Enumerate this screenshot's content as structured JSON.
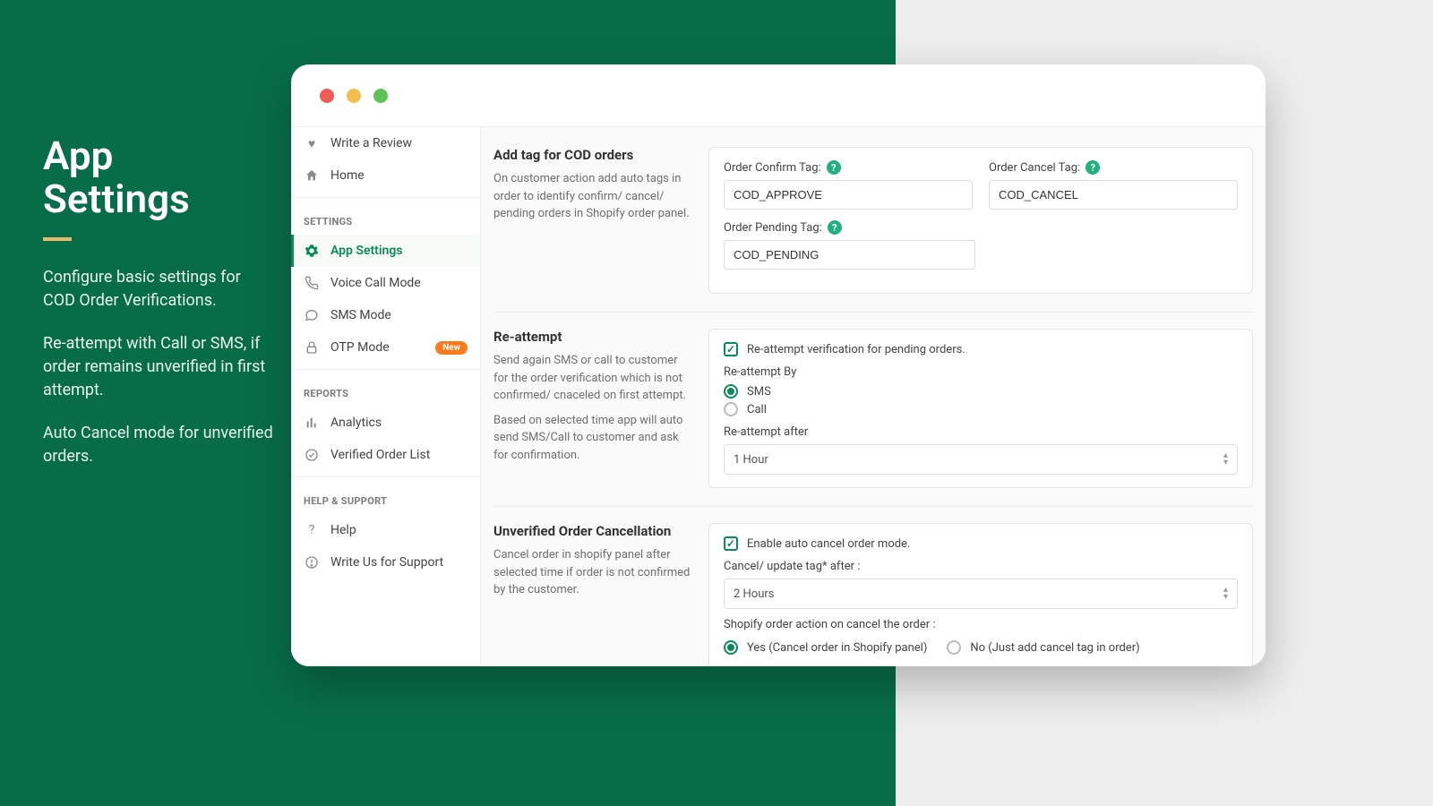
{
  "hero": {
    "title_l1": "App",
    "title_l2": "Settings",
    "p1": "Configure basic settings for COD Order Verifications.",
    "p2": "Re-attempt with Call or SMS, if order remains unverified in first attempt.",
    "p3": "Auto Cancel mode for unverified orders."
  },
  "sidebar": {
    "top": [
      {
        "label": "Write a Review",
        "icon": "heart"
      },
      {
        "label": "Home",
        "icon": "home"
      }
    ],
    "sections": {
      "settings_title": "SETTINGS",
      "reports_title": "REPORTS",
      "help_title": "HELP & SUPPORT"
    },
    "settings": [
      {
        "label": "App Settings",
        "icon": "gear",
        "active": true
      },
      {
        "label": "Voice Call Mode",
        "icon": "phone"
      },
      {
        "label": "SMS Mode",
        "icon": "sms"
      },
      {
        "label": "OTP Mode",
        "icon": "lock",
        "badge": "New"
      }
    ],
    "reports": [
      {
        "label": "Analytics",
        "icon": "chart"
      },
      {
        "label": "Verified Order List",
        "icon": "check-list"
      }
    ],
    "help": [
      {
        "label": "Help",
        "icon": "question"
      },
      {
        "label": "Write Us for Support",
        "icon": "exclaim"
      }
    ]
  },
  "sections": {
    "tags": {
      "title": "Add tag for COD orders",
      "desc": "On customer action add auto tags in order to identify confirm/ cancel/ pending orders in Shopify order panel.",
      "fields": {
        "confirm": {
          "label": "Order Confirm Tag:",
          "value": "COD_APPROVE"
        },
        "cancel": {
          "label": "Order Cancel Tag:",
          "value": "COD_CANCEL"
        },
        "pending": {
          "label": "Order Pending Tag:",
          "value": "COD_PENDING"
        }
      }
    },
    "reattempt": {
      "title": "Re-attempt",
      "desc1": "Send again SMS or call to customer for the order verification which is not confirmed/ cnaceled on first attempt.",
      "desc2": "Based on selected time app will auto send SMS/Call to customer and ask for confirmation.",
      "checkbox": "Re-attempt verification for pending orders.",
      "by_label": "Re-attempt By",
      "by_options": {
        "sms": "SMS",
        "call": "Call"
      },
      "by_selected": "sms",
      "after_label": "Re-attempt after",
      "after_value": "1 Hour"
    },
    "cancel": {
      "title": "Unverified Order Cancellation",
      "desc": "Cancel order in shopify panel after selected time if order is not confirmed by the customer.",
      "checkbox": "Enable auto cancel order mode.",
      "after_label": "Cancel/ update tag* after :",
      "after_value": "2 Hours",
      "action_label": "Shopify order action on cancel the order :",
      "action_options": {
        "yes": "Yes (Cancel order in Shopify panel)",
        "no": "No (Just add cancel tag in order)"
      },
      "action_selected": "yes"
    }
  }
}
